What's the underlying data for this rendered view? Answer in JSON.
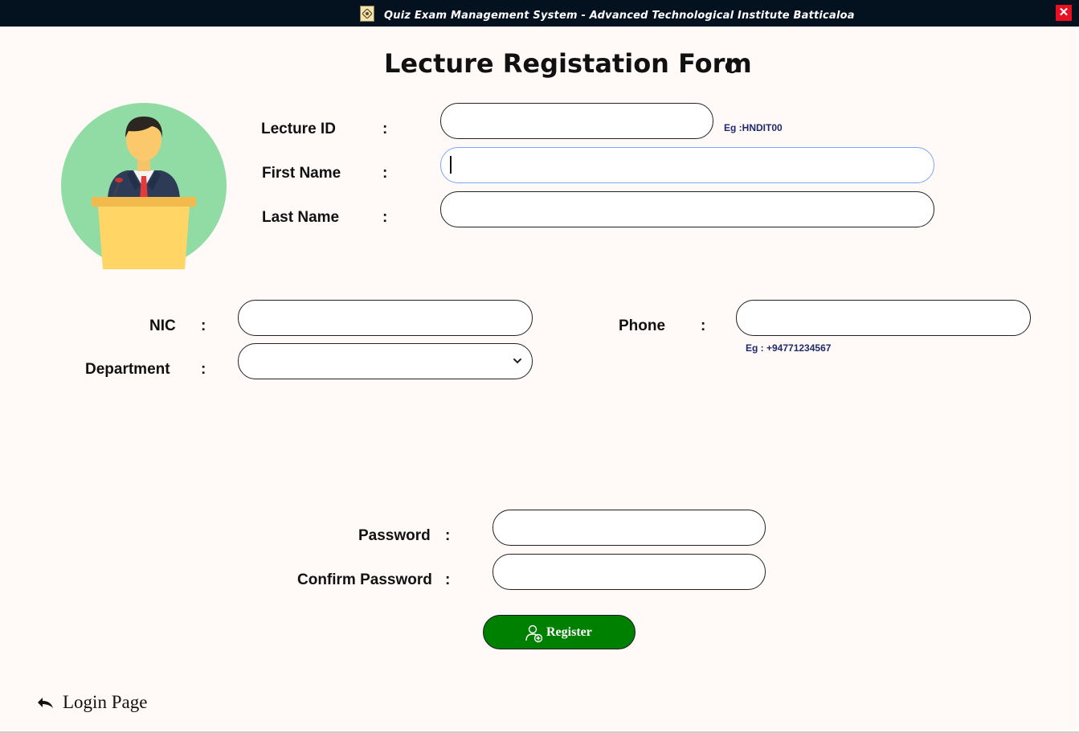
{
  "window": {
    "title": "Quiz Exam Management System  -  Advanced Technological Institute  Batticaloa",
    "close_label": "✕",
    "accent_color": "#008000"
  },
  "form": {
    "title": "Lecture Registation Form",
    "refresh_icon": "refresh-icon",
    "avatar_icon": "lecturer-at-podium-icon",
    "colon": ":"
  },
  "fields": {
    "lecture_id": {
      "label": "Lecture ID",
      "value": "",
      "hint": "Eg :HNDIT00"
    },
    "first_name": {
      "label": "First Name",
      "value": ""
    },
    "last_name": {
      "label": "Last Name",
      "value": ""
    },
    "nic": {
      "label": "NIC",
      "value": ""
    },
    "department": {
      "label": "Department",
      "value": ""
    },
    "phone": {
      "label": "Phone",
      "value": "",
      "hint": "Eg : +94771234567"
    },
    "password": {
      "label": "Password",
      "value": ""
    },
    "confirm_password": {
      "label": "Confirm Password",
      "value": ""
    }
  },
  "actions": {
    "register_label": "Register",
    "register_icon": "add-user-icon",
    "login_label": "Login Page",
    "login_icon": "back-arrow-icon"
  }
}
